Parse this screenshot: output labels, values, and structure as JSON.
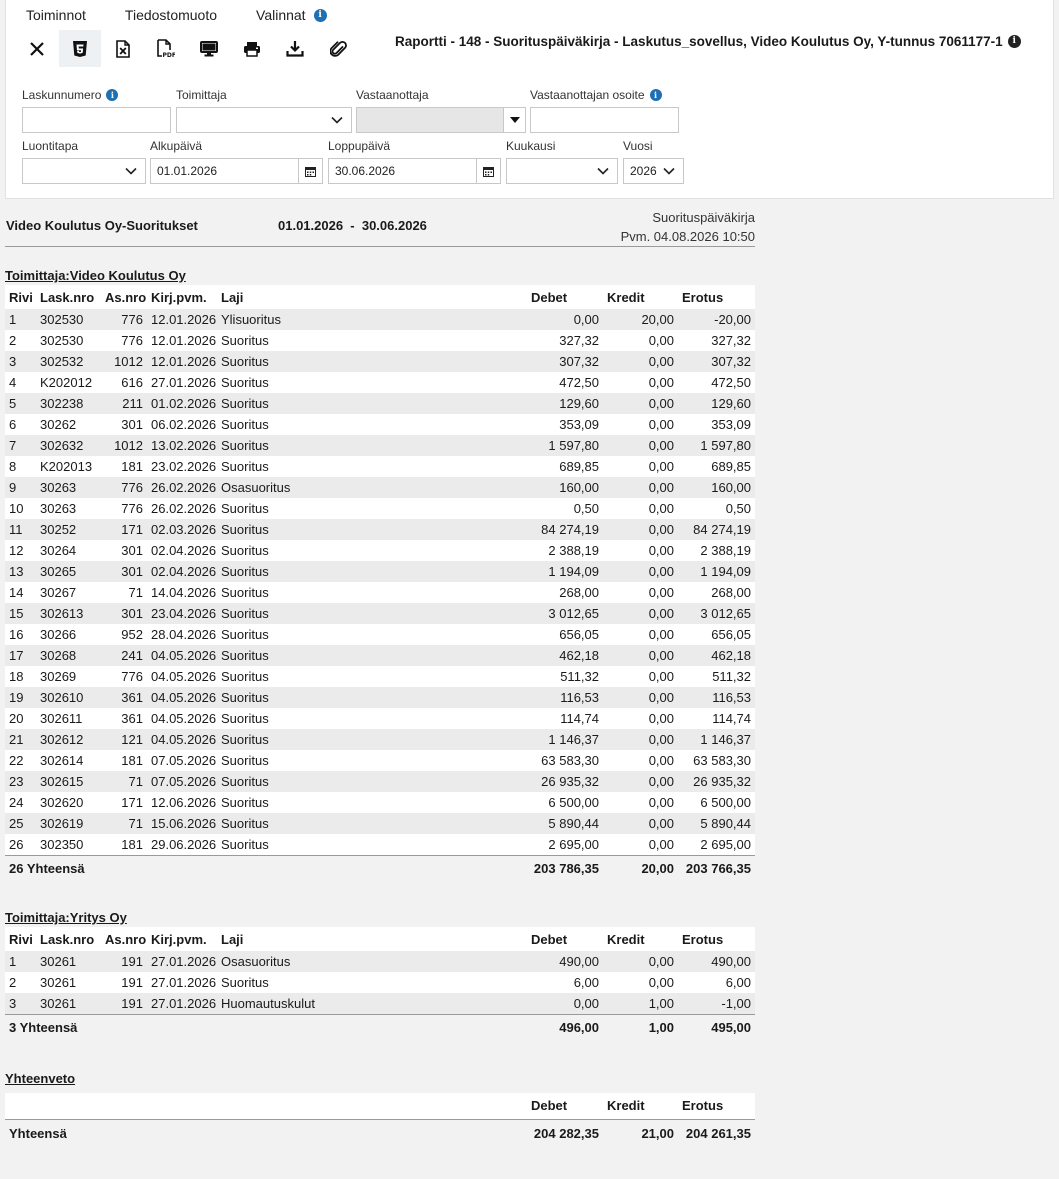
{
  "menu": [
    {
      "label": "Toiminnot",
      "info": false
    },
    {
      "label": "Tiedostomuoto",
      "info": false
    },
    {
      "label": "Valinnat",
      "info": true
    }
  ],
  "toolbar": [
    {
      "icon": "close-icon"
    },
    {
      "icon": "html5-icon"
    },
    {
      "icon": "excel-icon"
    },
    {
      "icon": "pdf-icon"
    },
    {
      "icon": "monitor-icon"
    },
    {
      "icon": "printer-icon"
    },
    {
      "icon": "download-icon"
    },
    {
      "icon": "paperclip-icon"
    }
  ],
  "report_title": "Raportti - 148 - Suorituspäiväkirja - Laskutus_sovellus, Video Koulutus Oy, Y-tunnus 7061177-1",
  "filters": {
    "invoice_number": {
      "label": "Laskunnumero",
      "value": ""
    },
    "supplier": {
      "label": "Toimittaja",
      "value": ""
    },
    "recipient": {
      "label": "Vastaanottaja",
      "value": ""
    },
    "recipient_address": {
      "label": "Vastaanottajan osoite",
      "value": ""
    },
    "creation_method": {
      "label": "Luontitapa",
      "value": ""
    },
    "start_date": {
      "label": "Alkupäivä",
      "value": "01.01.2026"
    },
    "end_date": {
      "label": "Loppupäivä",
      "value": "30.06.2026"
    },
    "month": {
      "label": "Kuukausi",
      "value": ""
    },
    "year": {
      "label": "Vuosi",
      "value": "2026"
    }
  },
  "report": {
    "company": "Video Koulutus Oy-Suoritukset",
    "range": "01.01.2026  -  30.06.2026",
    "doc_name": "Suorituspäiväkirja",
    "printed": "Pvm. 04.08.2026 10:50"
  },
  "columns": [
    "Rivi",
    "Lask.nro",
    "As.nro",
    "Kirj.pvm.",
    "Laji",
    "Debet",
    "Kredit",
    "Erotus"
  ],
  "groups": [
    {
      "title": "Toimittaja:Video Koulutus Oy",
      "rows": [
        [
          "1",
          "302530",
          "776",
          "12.01.2026",
          "Ylisuoritus",
          "0,00",
          "20,00",
          "-20,00"
        ],
        [
          "2",
          "302530",
          "776",
          "12.01.2026",
          "Suoritus",
          "327,32",
          "0,00",
          "327,32"
        ],
        [
          "3",
          "302532",
          "1012",
          "12.01.2026",
          "Suoritus",
          "307,32",
          "0,00",
          "307,32"
        ],
        [
          "4",
          "K202012",
          "616",
          "27.01.2026",
          "Suoritus",
          "472,50",
          "0,00",
          "472,50"
        ],
        [
          "5",
          "302238",
          "211",
          "01.02.2026",
          "Suoritus",
          "129,60",
          "0,00",
          "129,60"
        ],
        [
          "6",
          "30262",
          "301",
          "06.02.2026",
          "Suoritus",
          "353,09",
          "0,00",
          "353,09"
        ],
        [
          "7",
          "302632",
          "1012",
          "13.02.2026",
          "Suoritus",
          "1 597,80",
          "0,00",
          "1 597,80"
        ],
        [
          "8",
          "K202013",
          "181",
          "23.02.2026",
          "Suoritus",
          "689,85",
          "0,00",
          "689,85"
        ],
        [
          "9",
          "30263",
          "776",
          "26.02.2026",
          "Osasuoritus",
          "160,00",
          "0,00",
          "160,00"
        ],
        [
          "10",
          "30263",
          "776",
          "26.02.2026",
          "Suoritus",
          "0,50",
          "0,00",
          "0,50"
        ],
        [
          "11",
          "30252",
          "171",
          "02.03.2026",
          "Suoritus",
          "84 274,19",
          "0,00",
          "84 274,19"
        ],
        [
          "12",
          "30264",
          "301",
          "02.04.2026",
          "Suoritus",
          "2 388,19",
          "0,00",
          "2 388,19"
        ],
        [
          "13",
          "30265",
          "301",
          "02.04.2026",
          "Suoritus",
          "1 194,09",
          "0,00",
          "1 194,09"
        ],
        [
          "14",
          "30267",
          "71",
          "14.04.2026",
          "Suoritus",
          "268,00",
          "0,00",
          "268,00"
        ],
        [
          "15",
          "302613",
          "301",
          "23.04.2026",
          "Suoritus",
          "3 012,65",
          "0,00",
          "3 012,65"
        ],
        [
          "16",
          "30266",
          "952",
          "28.04.2026",
          "Suoritus",
          "656,05",
          "0,00",
          "656,05"
        ],
        [
          "17",
          "30268",
          "241",
          "04.05.2026",
          "Suoritus",
          "462,18",
          "0,00",
          "462,18"
        ],
        [
          "18",
          "30269",
          "776",
          "04.05.2026",
          "Suoritus",
          "511,32",
          "0,00",
          "511,32"
        ],
        [
          "19",
          "302610",
          "361",
          "04.05.2026",
          "Suoritus",
          "116,53",
          "0,00",
          "116,53"
        ],
        [
          "20",
          "302611",
          "361",
          "04.05.2026",
          "Suoritus",
          "114,74",
          "0,00",
          "114,74"
        ],
        [
          "21",
          "302612",
          "121",
          "04.05.2026",
          "Suoritus",
          "1 146,37",
          "0,00",
          "1 146,37"
        ],
        [
          "22",
          "302614",
          "181",
          "07.05.2026",
          "Suoritus",
          "63 583,30",
          "0,00",
          "63 583,30"
        ],
        [
          "23",
          "302615",
          "71",
          "07.05.2026",
          "Suoritus",
          "26 935,32",
          "0,00",
          "26 935,32"
        ],
        [
          "24",
          "302620",
          "171",
          "12.06.2026",
          "Suoritus",
          "6 500,00",
          "0,00",
          "6 500,00"
        ],
        [
          "25",
          "302619",
          "71",
          "15.06.2026",
          "Suoritus",
          "5 890,44",
          "0,00",
          "5 890,44"
        ],
        [
          "26",
          "302350",
          "181",
          "29.06.2026",
          "Suoritus",
          "2 695,00",
          "0,00",
          "2 695,00"
        ]
      ],
      "total": {
        "label": "26 Yhteensä",
        "debet": "203 786,35",
        "kredit": "20,00",
        "erotus": "203 766,35"
      }
    },
    {
      "title": "Toimittaja:Yritys Oy",
      "rows": [
        [
          "1",
          "30261",
          "191",
          "27.01.2026",
          "Osasuoritus",
          "490,00",
          "0,00",
          "490,00"
        ],
        [
          "2",
          "30261",
          "191",
          "27.01.2026",
          "Suoritus",
          "6,00",
          "0,00",
          "6,00"
        ],
        [
          "3",
          "30261",
          "191",
          "27.01.2026",
          "Huomautuskulut",
          "0,00",
          "1,00",
          "-1,00"
        ]
      ],
      "total": {
        "label": "3 Yhteensä",
        "debet": "496,00",
        "kredit": "1,00",
        "erotus": "495,00"
      }
    }
  ],
  "summary": {
    "title": "Yhteenveto",
    "columns": [
      "Debet",
      "Kredit",
      "Erotus"
    ],
    "label": "Yhteensä",
    "debet": "204 282,35",
    "kredit": "21,00",
    "erotus": "204 261,35"
  }
}
